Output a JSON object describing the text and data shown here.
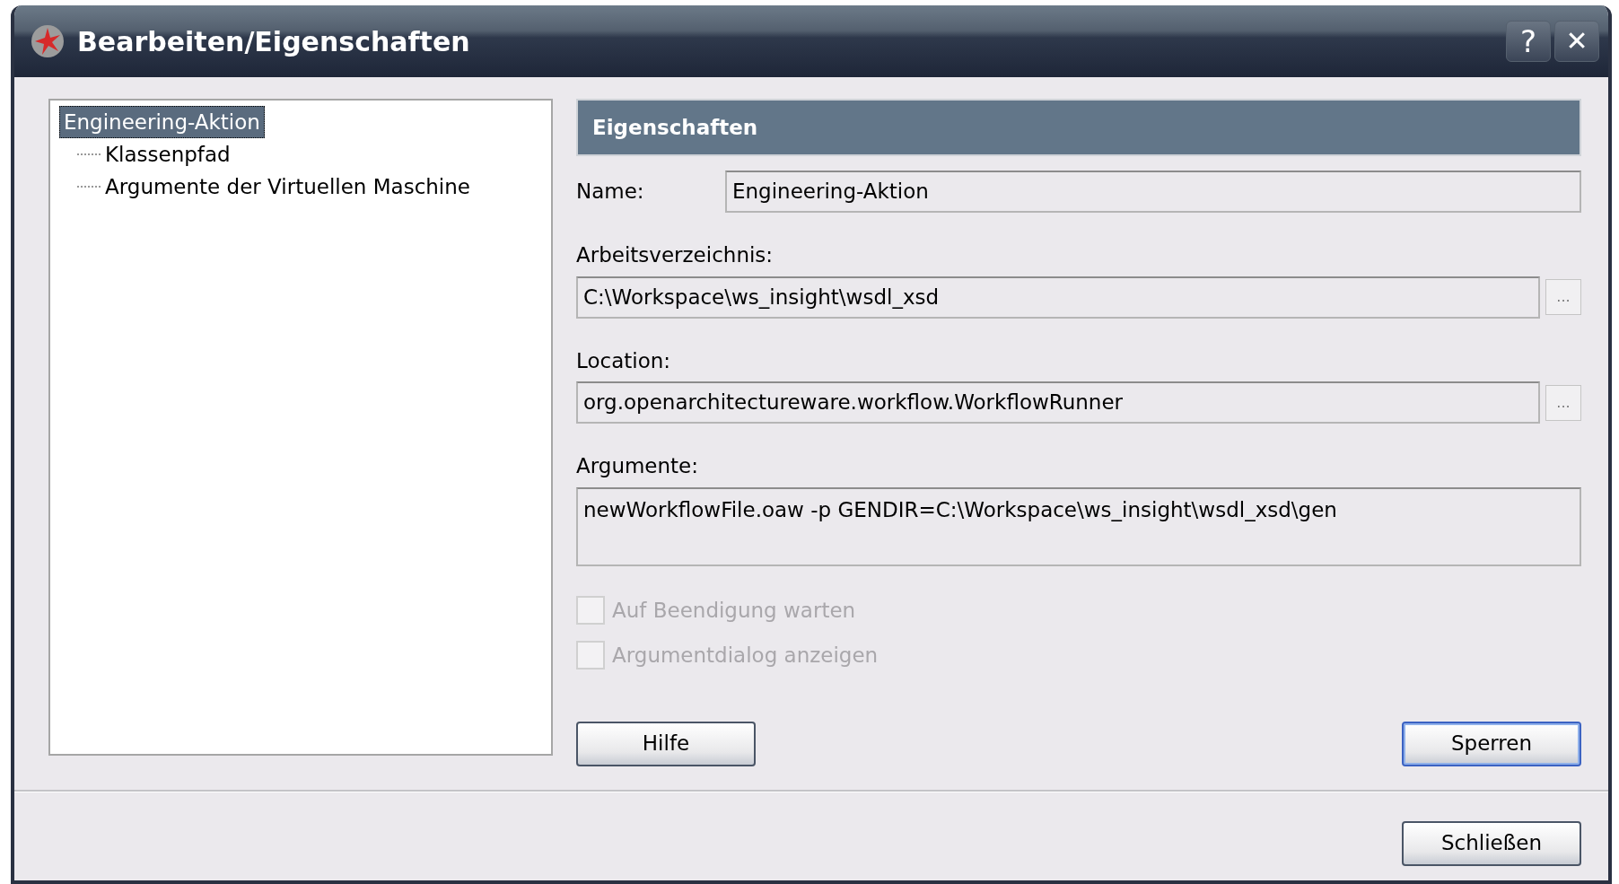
{
  "window": {
    "title": "Bearbeiten/Eigenschaften",
    "title_buttons": [
      {
        "kind": "help",
        "label": "?"
      },
      {
        "kind": "close",
        "label": "✕"
      }
    ]
  },
  "tree": {
    "items": [
      {
        "label": "Engineering-Aktion",
        "selected": true,
        "children": [
          {
            "label": "Klassenpfad",
            "selected": false
          },
          {
            "label": "Argumente der Virtuellen Maschine",
            "selected": false
          }
        ]
      }
    ]
  },
  "properties": {
    "header": "Eigenschaften",
    "name": {
      "label": "Name:",
      "value": "Engineering-Aktion"
    },
    "fields": [
      {
        "label": "Arbeitsverzeichnis:",
        "value": "C:\\Workspace\\ws_insight\\wsdl_xsd",
        "browse": "..."
      },
      {
        "label": "Location:",
        "value": "org.openarchitectureware.workflow.WorkflowRunner",
        "browse": "..."
      }
    ],
    "arguments": {
      "label": "Argumente:",
      "value": "newWorkflowFile.oaw -p GENDIR=C:\\Workspace\\ws_insight\\wsdl_xsd\\gen"
    },
    "checkboxes": [
      {
        "label": "Auf Beendigung warten",
        "checked": false,
        "disabled": true
      },
      {
        "label": "Argumentdialog anzeigen",
        "checked": false,
        "disabled": true
      }
    ],
    "buttons": [
      {
        "label": "Hilfe",
        "default": false
      },
      {
        "label": "Sperren",
        "default": true
      }
    ]
  },
  "footer_buttons": [
    {
      "label": "Schließen",
      "default": false
    }
  ]
}
